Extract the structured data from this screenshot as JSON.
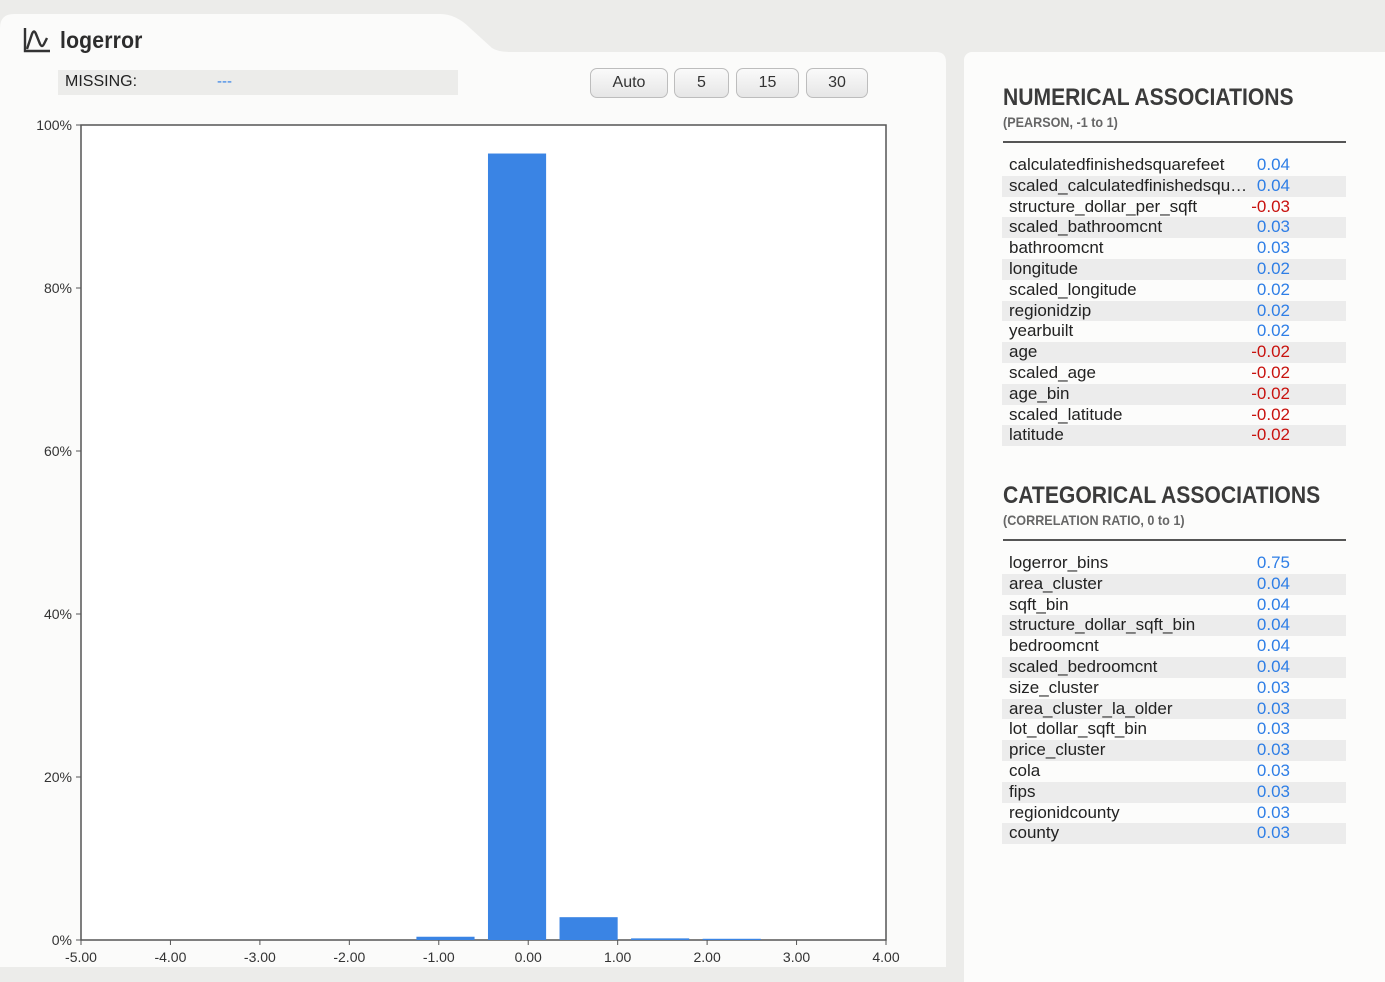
{
  "panel": {
    "title": "logerror",
    "missing_label": "MISSING:",
    "missing_value": "---",
    "bin_buttons": [
      "Auto",
      "5",
      "15",
      "30"
    ]
  },
  "colors": {
    "bar": "#3a84e4",
    "positive": "#2e7ee6",
    "negative": "#c8120e"
  },
  "icons": {
    "title": "line-chart-icon"
  },
  "chart_data": {
    "type": "bar",
    "xlim": [
      -5,
      4
    ],
    "ylim": [
      0,
      100
    ],
    "x_ticks": [
      "-5.00",
      "-4.00",
      "-3.00",
      "-2.00",
      "-1.00",
      "0.00",
      "1.00",
      "2.00",
      "3.00",
      "4.00"
    ],
    "y_ticks": [
      "0%",
      "20%",
      "40%",
      "60%",
      "80%",
      "100%"
    ],
    "bins": [
      {
        "x0": -1.25,
        "x1": -0.6,
        "value": 0.4
      },
      {
        "x0": -0.45,
        "x1": 0.2,
        "value": 96.5
      },
      {
        "x0": 0.35,
        "x1": 1.0,
        "value": 2.8
      },
      {
        "x0": 1.15,
        "x1": 1.8,
        "value": 0.2
      },
      {
        "x0": 1.95,
        "x1": 2.6,
        "value": 0.15
      }
    ]
  },
  "numerical": {
    "title": "NUMERICAL ASSOCIATIONS",
    "subtitle": "(PEARSON, -1 to 1)",
    "rows": [
      {
        "name": "calculatedfinishedsquarefeet",
        "value": "0.04",
        "sign": "pos"
      },
      {
        "name": "scaled_calculatedfinishedsquarefeet",
        "value": "0.04",
        "sign": "pos"
      },
      {
        "name": "structure_dollar_per_sqft",
        "value": "-0.03",
        "sign": "neg"
      },
      {
        "name": "scaled_bathroomcnt",
        "value": "0.03",
        "sign": "pos"
      },
      {
        "name": "bathroomcnt",
        "value": "0.03",
        "sign": "pos"
      },
      {
        "name": "longitude",
        "value": "0.02",
        "sign": "pos"
      },
      {
        "name": "scaled_longitude",
        "value": "0.02",
        "sign": "pos"
      },
      {
        "name": "regionidzip",
        "value": "0.02",
        "sign": "pos"
      },
      {
        "name": "yearbuilt",
        "value": "0.02",
        "sign": "pos"
      },
      {
        "name": "age",
        "value": "-0.02",
        "sign": "neg"
      },
      {
        "name": "scaled_age",
        "value": "-0.02",
        "sign": "neg"
      },
      {
        "name": "age_bin",
        "value": "-0.02",
        "sign": "neg"
      },
      {
        "name": "scaled_latitude",
        "value": "-0.02",
        "sign": "neg"
      },
      {
        "name": "latitude",
        "value": "-0.02",
        "sign": "neg"
      }
    ]
  },
  "categorical": {
    "title": "CATEGORICAL ASSOCIATIONS",
    "subtitle": "(CORRELATION RATIO, 0 to 1)",
    "rows": [
      {
        "name": "logerror_bins",
        "value": "0.75",
        "sign": "pos"
      },
      {
        "name": "area_cluster",
        "value": "0.04",
        "sign": "pos"
      },
      {
        "name": "sqft_bin",
        "value": "0.04",
        "sign": "pos"
      },
      {
        "name": "structure_dollar_sqft_bin",
        "value": "0.04",
        "sign": "pos"
      },
      {
        "name": "bedroomcnt",
        "value": "0.04",
        "sign": "pos"
      },
      {
        "name": "scaled_bedroomcnt",
        "value": "0.04",
        "sign": "pos"
      },
      {
        "name": "size_cluster",
        "value": "0.03",
        "sign": "pos"
      },
      {
        "name": "area_cluster_la_older",
        "value": "0.03",
        "sign": "pos"
      },
      {
        "name": "lot_dollar_sqft_bin",
        "value": "0.03",
        "sign": "pos"
      },
      {
        "name": "price_cluster",
        "value": "0.03",
        "sign": "pos"
      },
      {
        "name": "cola",
        "value": "0.03",
        "sign": "pos"
      },
      {
        "name": "fips",
        "value": "0.03",
        "sign": "pos"
      },
      {
        "name": "regionidcounty",
        "value": "0.03",
        "sign": "pos"
      },
      {
        "name": "county",
        "value": "0.03",
        "sign": "pos"
      }
    ]
  }
}
